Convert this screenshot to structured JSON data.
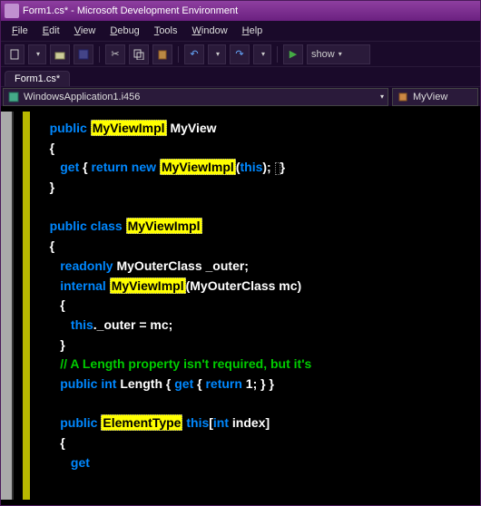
{
  "title": "Form1.cs* - Microsoft Development Environment",
  "menus": {
    "file": "File",
    "edit": "Edit",
    "view": "View",
    "debug": "Debug",
    "tools": "Tools",
    "window": "Window",
    "help": "Help"
  },
  "toolbar": {
    "show": "show"
  },
  "tab": "Form1.cs*",
  "nav": {
    "left": "WindowsApplication1.i456",
    "right": "MyView"
  },
  "code": {
    "l1_kw": "public",
    "l1_hl": "MyViewImpl",
    "l1_id": "MyView",
    "l2": "{",
    "l3_kw": "get",
    "l3_b1": " { ",
    "l3_kw2": "return new",
    "l3_hl": "MyViewImpl",
    "l3_rest": "(",
    "l3_kw3": "this",
    "l3_close": ");",
    "l3_end": "}",
    "l4": "}",
    "l5_kw": "public class",
    "l5_hl": "MyViewImpl",
    "l6": "{",
    "l7_kw": "readonly",
    "l7_rest": " MyOuterClass _outer;",
    "l8_kw": "internal",
    "l8_hl": "MyViewImpl",
    "l8_rest": "(MyOuterClass mc)",
    "l9": "{",
    "l10_kw": "this",
    "l10_rest": "._outer = mc;",
    "l11": "}",
    "l12": "// A Length property isn't required, but it's ",
    "l13_kw": "public int",
    "l13_rest": " Length { ",
    "l13_kw2": "get",
    "l13_rest2": " { ",
    "l13_kw3": "return",
    "l13_rest3": " 1; } }",
    "l14_kw": "public",
    "l14_hl": "ElementType",
    "l14_kw2": "this",
    "l14_rest": "[",
    "l14_kw3": "int",
    "l14_rest2": " index]",
    "l15": "{",
    "l16_kw": "get"
  }
}
